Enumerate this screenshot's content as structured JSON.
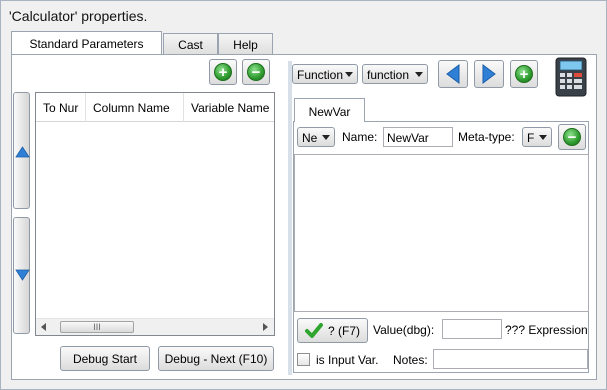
{
  "window": {
    "title": "'Calculator' properties."
  },
  "tabs": [
    {
      "label": "Standard Parameters",
      "active": true
    },
    {
      "label": "Cast",
      "active": false
    },
    {
      "label": "Help",
      "active": false
    }
  ],
  "left": {
    "add_icon": "plus-circle-icon",
    "remove_icon": "minus-circle-icon",
    "columns": [
      "To Nur",
      "Column Name",
      "Variable Name"
    ],
    "scroll_thumb_grip": "III",
    "debug_start_label": "Debug Start",
    "debug_next_label": "Debug - Next (F10)"
  },
  "right": {
    "combo1_value": "Function",
    "combo2_value": "function",
    "calculator_icon": "calculator-icon",
    "inner_tab_label": "NewVar",
    "new_combo_value": "Ne",
    "name_label": "Name:",
    "name_value": "NewVar",
    "meta_type_label": "Meta-type:",
    "meta_type_value": "F",
    "check_button_label": "? (F7)",
    "value_label": "Value(dbg):",
    "value_field": "",
    "expression_label": "??? Expression",
    "is_input_var_label": "is Input Var.",
    "is_input_var_checked": false,
    "notes_label": "Notes:",
    "notes_value": ""
  },
  "colors": {
    "arrow_blue": "#2f7fd6",
    "add_green": "#2e9a2e",
    "remove_green": "#2e9a2e"
  }
}
